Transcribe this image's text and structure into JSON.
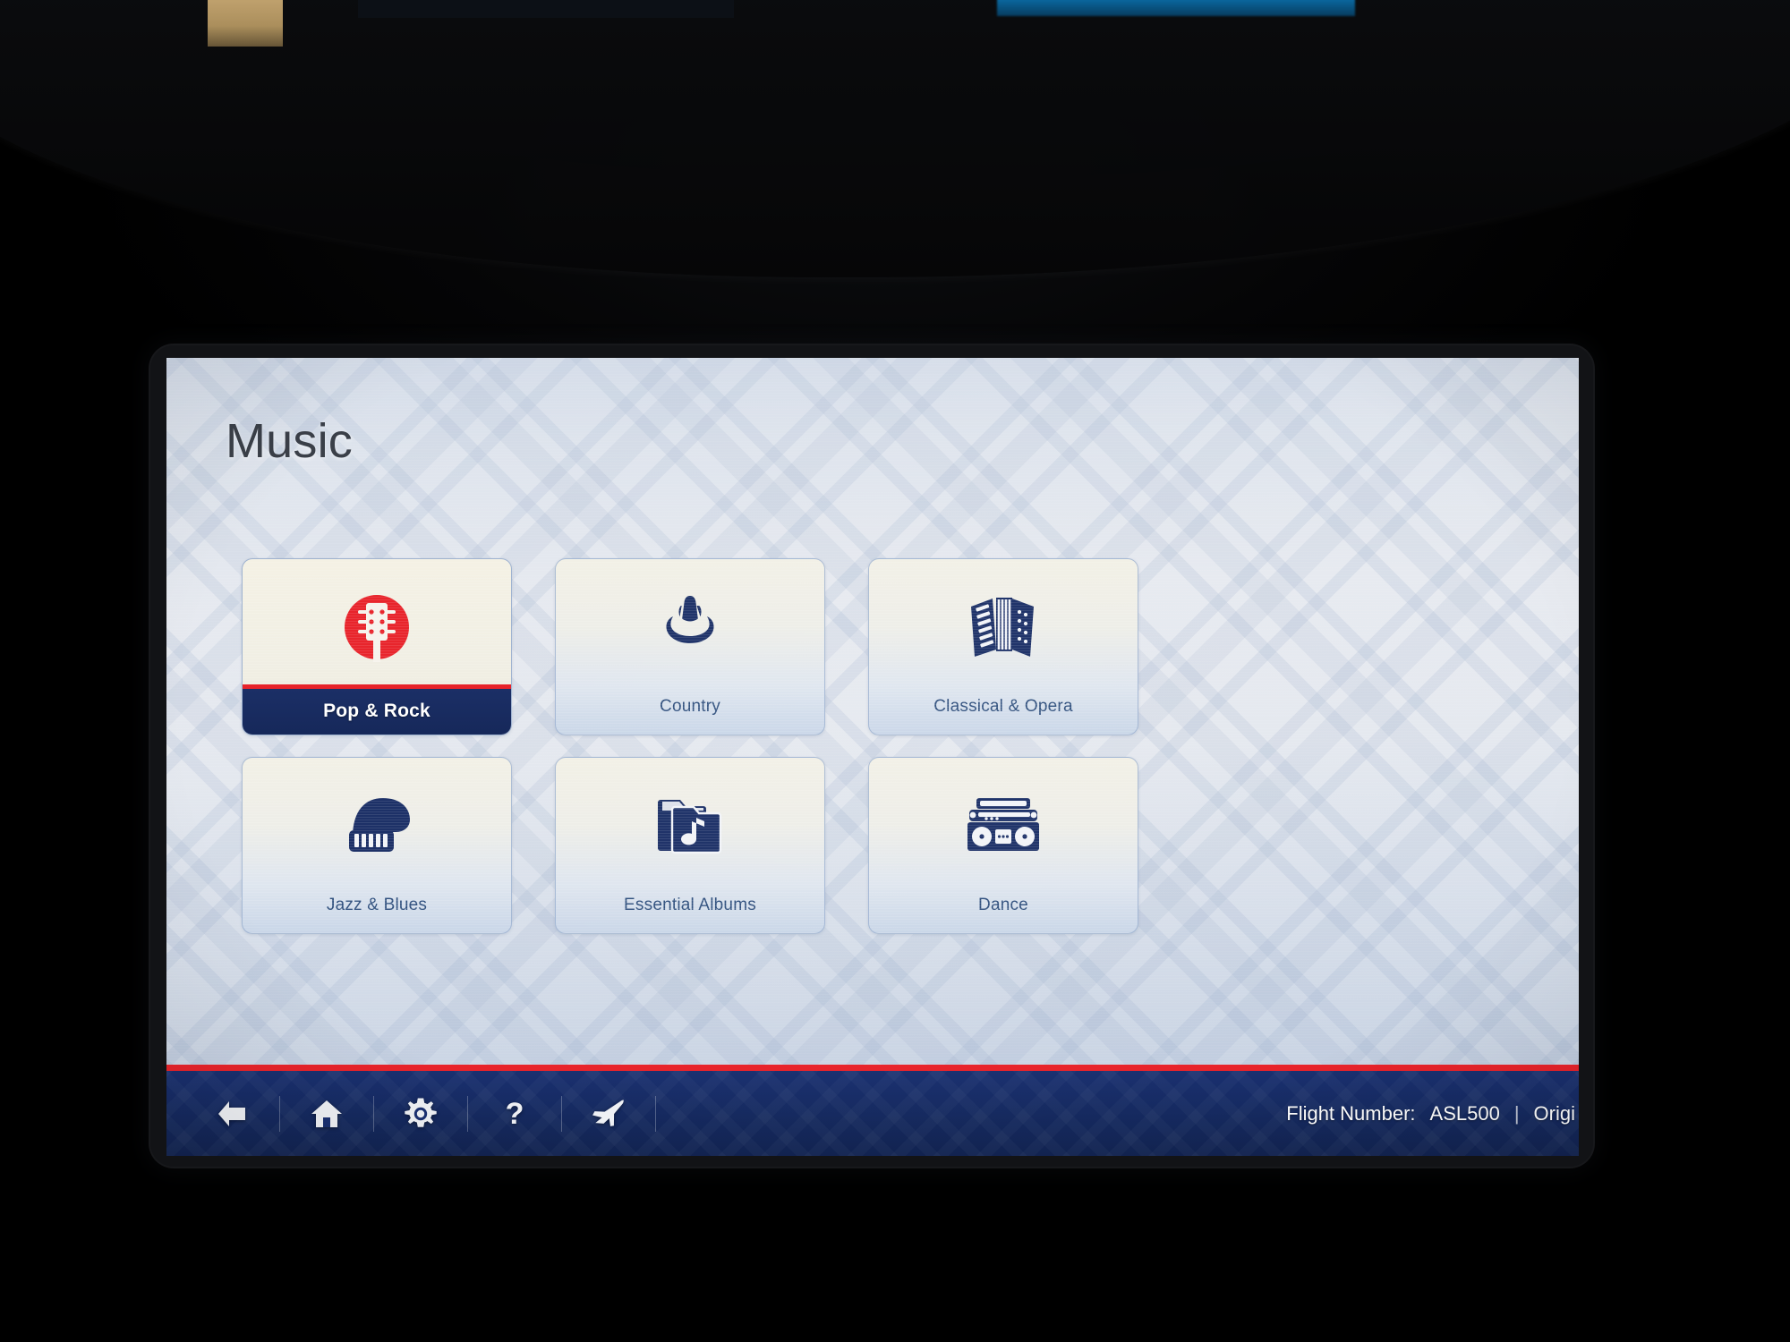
{
  "screen": {
    "title": "Music",
    "accent_red": "#e8232a",
    "accent_navy": "#16285a",
    "label_blue": "#2f4f7d"
  },
  "tiles": [
    {
      "label": "Pop & Rock",
      "icon": "guitar-headstock-icon",
      "selected": true
    },
    {
      "label": "Country",
      "icon": "cowboy-hat-icon",
      "selected": false
    },
    {
      "label": "Classical & Opera",
      "icon": "accordion-icon",
      "selected": false
    },
    {
      "label": "Jazz & Blues",
      "icon": "grand-piano-icon",
      "selected": false
    },
    {
      "label": "Essential Albums",
      "icon": "music-folder-icon",
      "selected": false
    },
    {
      "label": "Dance",
      "icon": "boombox-icon",
      "selected": false
    }
  ],
  "footer": {
    "nav": [
      {
        "icon": "back-arrow-icon"
      },
      {
        "icon": "home-icon"
      },
      {
        "icon": "gear-icon"
      },
      {
        "icon": "question-mark-icon"
      },
      {
        "icon": "airplane-icon"
      }
    ],
    "flight": {
      "number_label": "Flight Number:",
      "number_value": "ASL500",
      "separator": "|",
      "origin_label_clipped": "Origi"
    }
  }
}
